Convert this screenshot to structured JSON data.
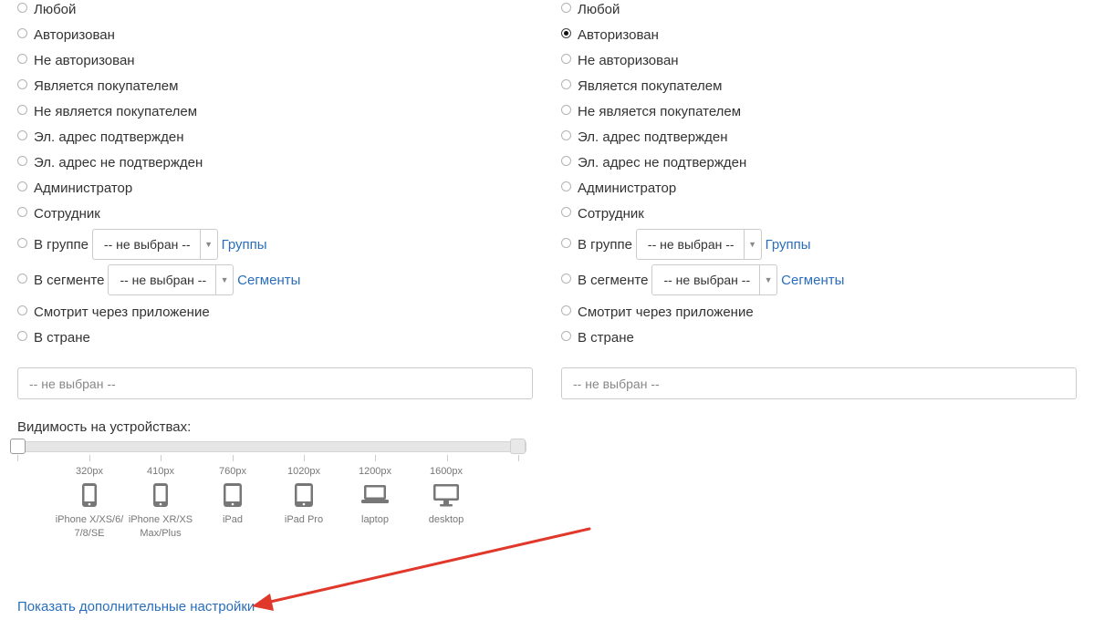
{
  "left": {
    "options": [
      {
        "label": "Любой",
        "checked": false
      },
      {
        "label": "Авторизован",
        "checked": false
      },
      {
        "label": "Не авторизован",
        "checked": false
      },
      {
        "label": "Является покупателем",
        "checked": false
      },
      {
        "label": "Не является покупателем",
        "checked": false
      },
      {
        "label": "Эл. адрес подтвержден",
        "checked": false
      },
      {
        "label": "Эл. адрес не подтвержден",
        "checked": false
      },
      {
        "label": "Администратор",
        "checked": false
      },
      {
        "label": "Сотрудник",
        "checked": false
      },
      {
        "label": "В группе",
        "checked": false,
        "select": "-- не выбран --",
        "link": "Группы"
      },
      {
        "label": "В сегменте",
        "checked": false,
        "select": "-- не выбран --",
        "link": "Сегменты"
      },
      {
        "label": "Смотрит через приложение",
        "checked": false
      },
      {
        "label": "В стране",
        "checked": false
      }
    ],
    "country_select": "-- не выбран --"
  },
  "right": {
    "options": [
      {
        "label": "Любой",
        "checked": false
      },
      {
        "label": "Авторизован",
        "checked": true
      },
      {
        "label": "Не авторизован",
        "checked": false
      },
      {
        "label": "Является покупателем",
        "checked": false
      },
      {
        "label": "Не является покупателем",
        "checked": false
      },
      {
        "label": "Эл. адрес подтвержден",
        "checked": false
      },
      {
        "label": "Эл. адрес не подтвержден",
        "checked": false
      },
      {
        "label": "Администратор",
        "checked": false
      },
      {
        "label": "Сотрудник",
        "checked": false
      },
      {
        "label": "В группе",
        "checked": false,
        "select": "-- не выбран --",
        "link": "Группы"
      },
      {
        "label": "В сегменте",
        "checked": false,
        "select": "-- не выбран --",
        "link": "Сегменты"
      },
      {
        "label": "Смотрит через приложение",
        "checked": false
      },
      {
        "label": "В стране",
        "checked": false
      }
    ],
    "country_select": "-- не выбран --"
  },
  "visibility": {
    "label": "Видимость на устройствах:",
    "range_from": 0,
    "range_to": 1,
    "devices": [
      {
        "px": "320px",
        "icon": "phone-icon",
        "name": "iPhone X/XS/6/ 7/8/SE"
      },
      {
        "px": "410px",
        "icon": "phone-icon",
        "name": "iPhone XR/XS Max/Plus"
      },
      {
        "px": "760px",
        "icon": "tablet-icon",
        "name": "iPad"
      },
      {
        "px": "1020px",
        "icon": "tablet-icon",
        "name": "iPad Pro"
      },
      {
        "px": "1200px",
        "icon": "laptop-icon",
        "name": "laptop"
      },
      {
        "px": "1600px",
        "icon": "desktop-icon",
        "name": "desktop"
      }
    ]
  },
  "more_settings_link": "Показать дополнительные настройки",
  "colors": {
    "link": "#2a6ebb",
    "annotation_arrow": "#e0392b",
    "icon": "#777777"
  }
}
